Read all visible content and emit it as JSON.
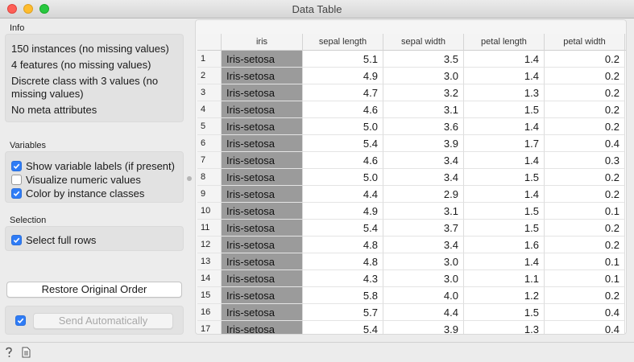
{
  "window": {
    "title": "Data Table"
  },
  "info": {
    "heading": "Info",
    "lines": [
      "150 instances (no missing values)",
      "4 features (no missing values)",
      "Discrete class with 3 values (no missing values)",
      "No meta attributes"
    ]
  },
  "variables": {
    "heading": "Variables",
    "options": [
      {
        "label": "Show variable labels (if present)",
        "checked": true
      },
      {
        "label": "Visualize numeric values",
        "checked": false
      },
      {
        "label": "Color by instance classes",
        "checked": true
      }
    ]
  },
  "selection": {
    "heading": "Selection",
    "options": [
      {
        "label": "Select full rows",
        "checked": true
      }
    ]
  },
  "buttons": {
    "restore": "Restore Original Order",
    "send": "Send Automatically",
    "send_auto_checked": true
  },
  "table": {
    "columns": [
      "iris",
      "sepal length",
      "sepal width",
      "petal length",
      "petal width"
    ],
    "class_color": "#9b9b9b",
    "rows": [
      {
        "idx": "1",
        "iris": "Iris-setosa",
        "v": [
          "5.1",
          "3.5",
          "1.4",
          "0.2"
        ]
      },
      {
        "idx": "2",
        "iris": "Iris-setosa",
        "v": [
          "4.9",
          "3.0",
          "1.4",
          "0.2"
        ]
      },
      {
        "idx": "3",
        "iris": "Iris-setosa",
        "v": [
          "4.7",
          "3.2",
          "1.3",
          "0.2"
        ]
      },
      {
        "idx": "4",
        "iris": "Iris-setosa",
        "v": [
          "4.6",
          "3.1",
          "1.5",
          "0.2"
        ]
      },
      {
        "idx": "5",
        "iris": "Iris-setosa",
        "v": [
          "5.0",
          "3.6",
          "1.4",
          "0.2"
        ]
      },
      {
        "idx": "6",
        "iris": "Iris-setosa",
        "v": [
          "5.4",
          "3.9",
          "1.7",
          "0.4"
        ]
      },
      {
        "idx": "7",
        "iris": "Iris-setosa",
        "v": [
          "4.6",
          "3.4",
          "1.4",
          "0.3"
        ]
      },
      {
        "idx": "8",
        "iris": "Iris-setosa",
        "v": [
          "5.0",
          "3.4",
          "1.5",
          "0.2"
        ]
      },
      {
        "idx": "9",
        "iris": "Iris-setosa",
        "v": [
          "4.4",
          "2.9",
          "1.4",
          "0.2"
        ]
      },
      {
        "idx": "10",
        "iris": "Iris-setosa",
        "v": [
          "4.9",
          "3.1",
          "1.5",
          "0.1"
        ]
      },
      {
        "idx": "11",
        "iris": "Iris-setosa",
        "v": [
          "5.4",
          "3.7",
          "1.5",
          "0.2"
        ]
      },
      {
        "idx": "12",
        "iris": "Iris-setosa",
        "v": [
          "4.8",
          "3.4",
          "1.6",
          "0.2"
        ]
      },
      {
        "idx": "13",
        "iris": "Iris-setosa",
        "v": [
          "4.8",
          "3.0",
          "1.4",
          "0.1"
        ]
      },
      {
        "idx": "14",
        "iris": "Iris-setosa",
        "v": [
          "4.3",
          "3.0",
          "1.1",
          "0.1"
        ]
      },
      {
        "idx": "15",
        "iris": "Iris-setosa",
        "v": [
          "5.8",
          "4.0",
          "1.2",
          "0.2"
        ]
      },
      {
        "idx": "16",
        "iris": "Iris-setosa",
        "v": [
          "5.7",
          "4.4",
          "1.5",
          "0.4"
        ]
      },
      {
        "idx": "17",
        "iris": "Iris-setosa",
        "v": [
          "5.4",
          "3.9",
          "1.3",
          "0.4"
        ]
      }
    ]
  },
  "statusbar": {
    "icons": [
      "help-icon",
      "report-icon"
    ]
  }
}
